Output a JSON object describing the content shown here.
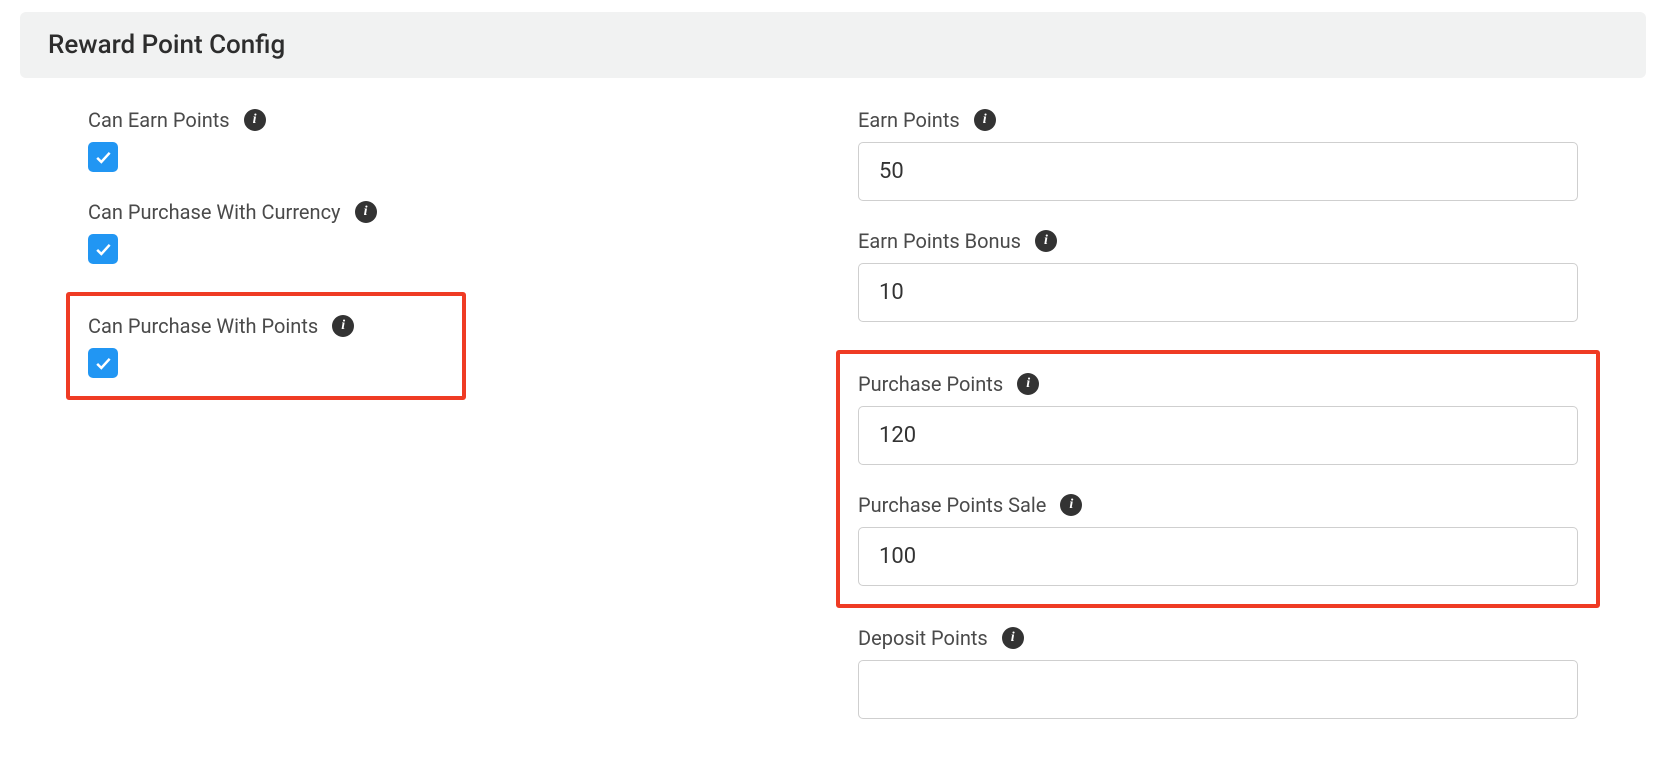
{
  "header": {
    "title": "Reward Point Config"
  },
  "left": {
    "can_earn_points": {
      "label": "Can Earn Points",
      "checked": true
    },
    "can_purchase_currency": {
      "label": "Can Purchase With Currency",
      "checked": true
    },
    "can_purchase_points": {
      "label": "Can Purchase With Points",
      "checked": true
    }
  },
  "right": {
    "earn_points": {
      "label": "Earn Points",
      "value": "50"
    },
    "earn_points_bonus": {
      "label": "Earn Points Bonus",
      "value": "10"
    },
    "purchase_points": {
      "label": "Purchase Points",
      "value": "120"
    },
    "purchase_points_sale": {
      "label": "Purchase Points Sale",
      "value": "100"
    },
    "deposit_points": {
      "label": "Deposit Points",
      "value": ""
    }
  },
  "icons": {
    "info_glyph": "i"
  }
}
